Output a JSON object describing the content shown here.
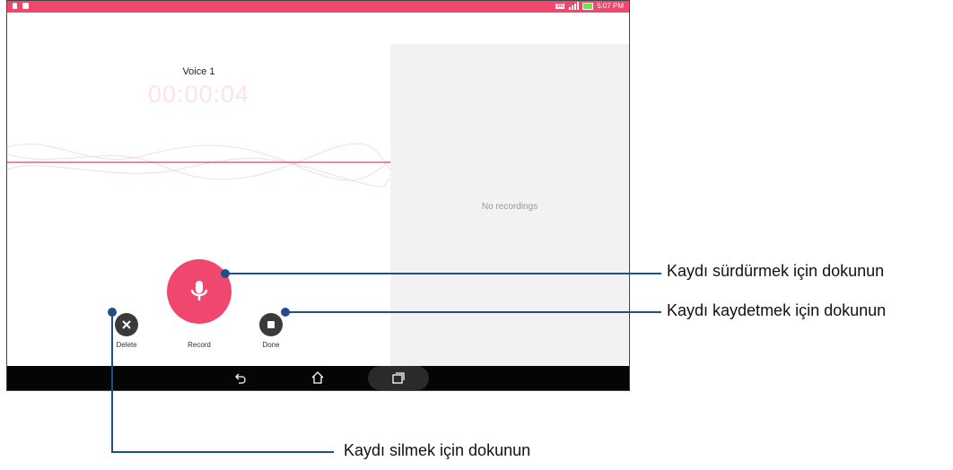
{
  "status_bar": {
    "badge": "3G",
    "time": "5:07 PM"
  },
  "recorder": {
    "recording_title": "Voice 1",
    "elapsed_time": "00:00:04",
    "delete_label": "Delete",
    "record_label": "Record",
    "done_label": "Done"
  },
  "recordings_panel": {
    "empty_text": "No recordings"
  },
  "callouts": {
    "record": "Kaydı sürdürmek için dokunun",
    "done": "Kaydı kaydetmek için dokunun",
    "delete": "Kaydı silmek için dokunun"
  },
  "colors": {
    "accent": "#f0476e",
    "callout_line": "#1f4e8c"
  }
}
